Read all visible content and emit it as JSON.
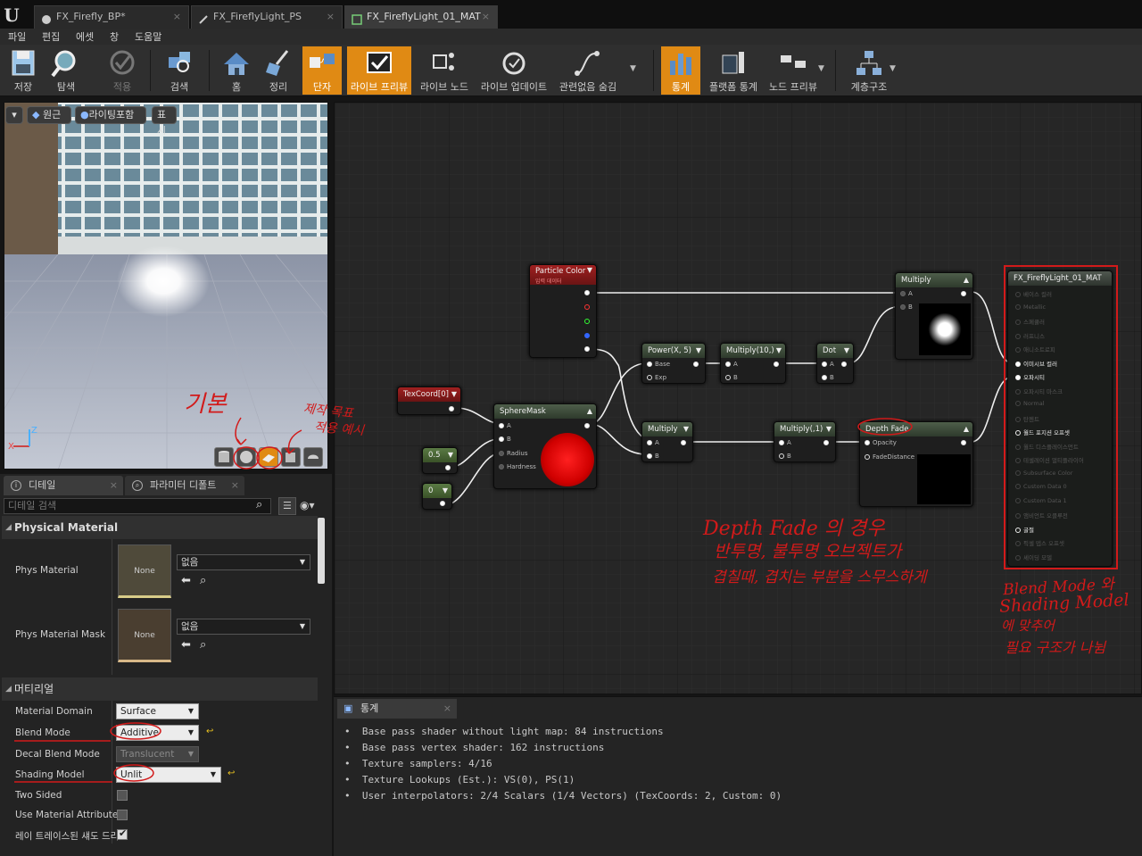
{
  "tabs": [
    {
      "label": "FX_Firefly_BP*"
    },
    {
      "label": "FX_FireflyLight_PS"
    },
    {
      "label": "FX_FireflyLight_01_MAT"
    }
  ],
  "menu": [
    "파일",
    "편집",
    "에셋",
    "창",
    "도움말"
  ],
  "toolbar": {
    "save": "저장",
    "browse": "탐색",
    "apply": "적용",
    "search": "검색",
    "home": "홈",
    "clean": "정리",
    "connectors": "단자",
    "live_preview": "라이브 프리뷰",
    "live_nodes": "라이브 노드",
    "live_update": "라이브 업데이트",
    "hide_unrelated": "관련없음 숨김",
    "stats": "통계",
    "platform_stats": "플랫폼 통계",
    "node_preview": "노드 프리뷰",
    "hierarchy": "계층구조"
  },
  "viewport": {
    "perspective": "원근",
    "lit": "라이팅포함",
    "show": "표시",
    "axis_x": "X",
    "axis_z": "Z"
  },
  "panel_tabs": {
    "details": "디테일",
    "param_defaults": "파라미터 디폴트"
  },
  "search_placeholder": "디테일 검색",
  "physical": {
    "section": "Physical Material",
    "phys_label": "Phys Material",
    "phys_none": "None",
    "phys_value": "없음",
    "mask_label": "Phys Material Mask",
    "mask_none": "None",
    "mask_value": "없음"
  },
  "material": {
    "section": "머티리얼",
    "domain_label": "Material Domain",
    "domain_value": "Surface",
    "blend_label": "Blend Mode",
    "blend_value": "Additive",
    "decal_label": "Decal Blend Mode",
    "decal_value": "Translucent",
    "shading_label": "Shading Model",
    "shading_value": "Unlit",
    "twosided_label": "Two Sided",
    "attr_label": "Use Material Attributes",
    "ray_label": "레이 트레이스된 섀도 드리"
  },
  "stats_tab": "통계",
  "stats": [
    "Base pass shader without light map: 84 instructions",
    "Base pass vertex shader: 162 instructions",
    "Texture samplers: 4/16",
    "Texture Lookups (Est.): VS(0), PS(1)",
    "User interpolators: 2/4 Scalars (1/4 Vectors) (TexCoords: 2, Custom: 0)"
  ],
  "nodes": {
    "particle": {
      "title": "Particle Color",
      "sub": "입력 데이터"
    },
    "texcoord": {
      "title": "TexCoord[0]"
    },
    "spheremask": {
      "title": "SphereMask",
      "pins": [
        "A",
        "B",
        "Radius",
        "Hardness"
      ]
    },
    "c05": {
      "title": "0.5"
    },
    "c0": {
      "title": "0"
    },
    "power": {
      "title": "Power(X, 5)",
      "pins": [
        "Base",
        "Exp"
      ]
    },
    "mult10": {
      "title": "Multiply(10,)",
      "pins": [
        "A",
        "B"
      ]
    },
    "dot": {
      "title": "Dot",
      "pins": [
        "A",
        "B"
      ]
    },
    "multiply_top": {
      "title": "Multiply",
      "pins": [
        "A",
        "B"
      ]
    },
    "multiply_mid": {
      "title": "Multiply",
      "pins": [
        "A",
        "B"
      ]
    },
    "mult1": {
      "title": "Multiply(,1)",
      "pins": [
        "A",
        "B"
      ]
    },
    "depthfade": {
      "title": "Depth Fade",
      "pins": [
        "Opacity",
        "FadeDistance"
      ]
    },
    "result": {
      "title": "FX_FireflyLight_01_MAT",
      "pins": [
        "베이스 컬러",
        "Metallic",
        "스페큘러",
        "러프니스",
        "애니소트로피",
        "이미시브 컬러",
        "오파시티",
        "오파시티 마스크",
        "Normal",
        "탄젠트",
        "월드 포지션 오프셋",
        "월드 디스플레이스먼트",
        "테셀레이션 멀티플라이어",
        "Subsurface Color",
        "Custom Data 0",
        "Custom Data 1",
        "앰비언트 오클루전",
        "굴절",
        "픽셀 뎁스 오프셋",
        "셰이딩 모델"
      ]
    }
  },
  "annotations": {
    "basic": "기본",
    "shape_note_1": "제작 목표",
    "shape_note_2": "적용 예시",
    "depth_1": "Depth Fade 의 경우",
    "depth_2": "반투명, 불투명 오브젝트가",
    "depth_3": "겹칠때, 겹치는 부분을 스무스하게",
    "blend_1": "Blend Mode 와",
    "blend_2": "Shading Model",
    "blend_3": "에 맞추어",
    "blend_4": "필요 구조가 나뉨"
  },
  "colors": {
    "accent": "#e08a14",
    "red_node": "#8a1c1c",
    "green_node": "#4a6a3a",
    "annotation": "#d21a1a"
  }
}
